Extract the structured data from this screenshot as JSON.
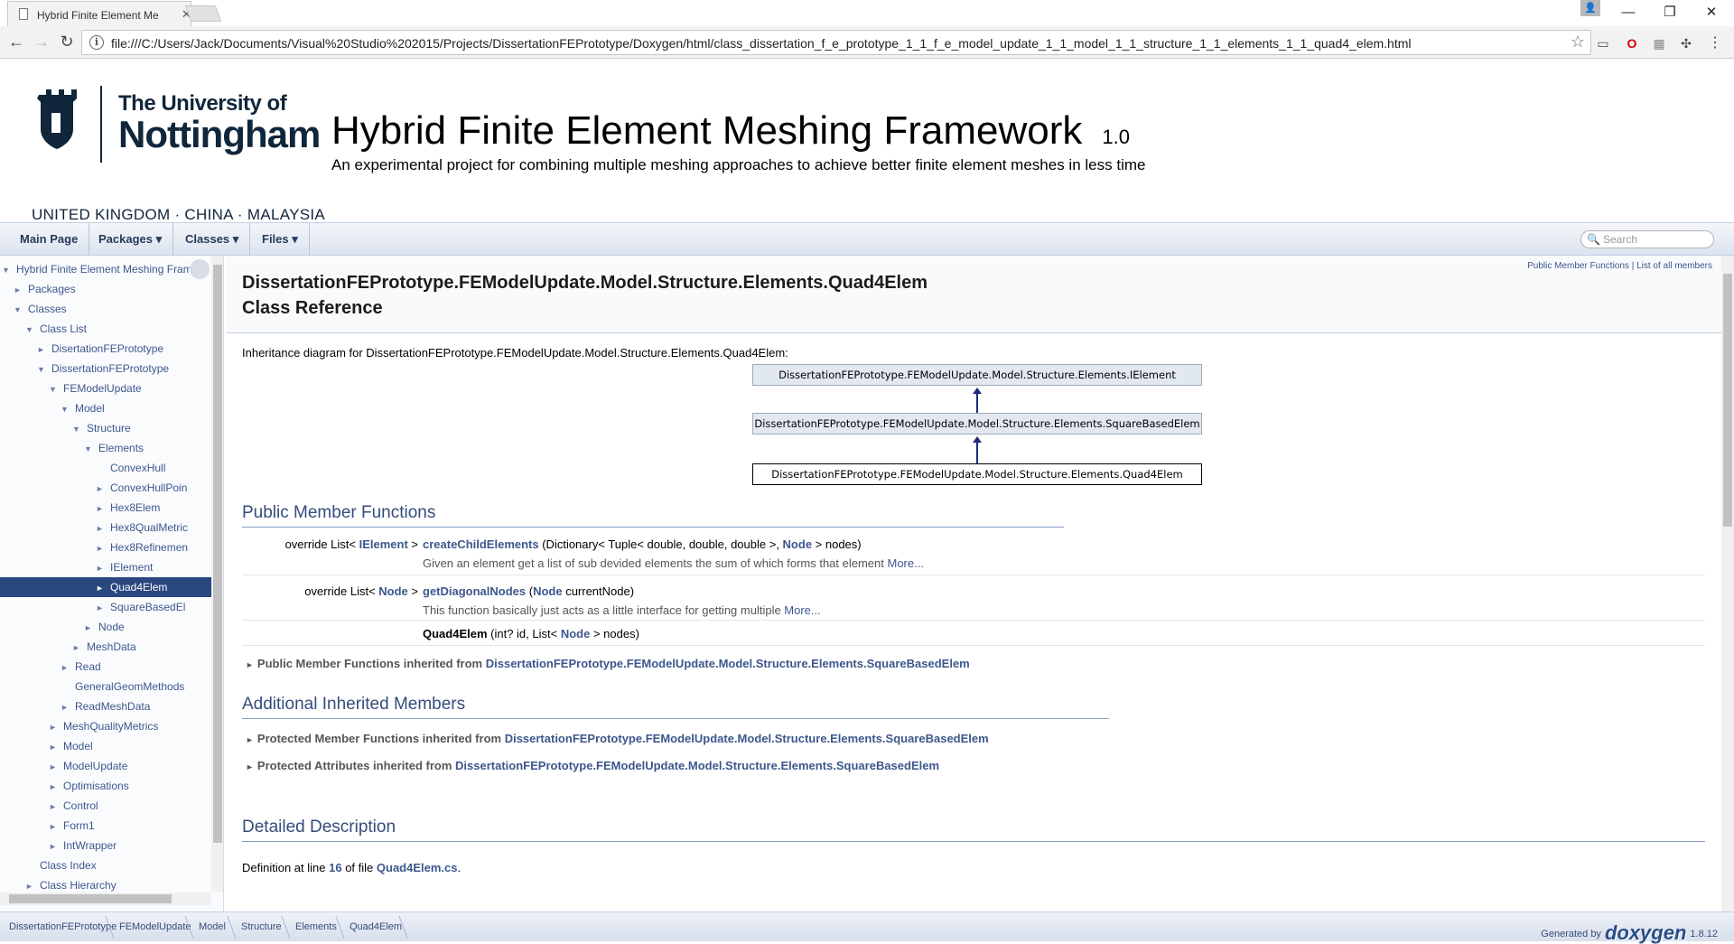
{
  "browser": {
    "tab_title": "Hybrid Finite Element Me",
    "url": "file:///C:/Users/Jack/Documents/Visual%20Studio%202015/Projects/DissertationFEPrototype/Doxygen/html/class_dissertation_f_e_prototype_1_1_f_e_model_update_1_1_model_1_1_structure_1_1_elements_1_1_quad4_elem.html"
  },
  "header": {
    "logo_line1": "The University of",
    "logo_line2": "Nottingham",
    "logo_countries": "UNITED KINGDOM · CHINA · MALAYSIA",
    "project_name": "Hybrid Finite Element Meshing Framework",
    "project_number": "1.0",
    "project_brief": "An experimental project for combining multiple meshing approaches to achieve better finite element meshes in less time"
  },
  "nav": {
    "main_page": "Main Page",
    "packages": "Packages",
    "classes": "Classes",
    "files": "Files",
    "search_placeholder": "Search"
  },
  "tree": [
    {
      "label": "Hybrid Finite Element Meshing Framew",
      "arrow": "▼",
      "depth": 0
    },
    {
      "label": "Packages",
      "arrow": "►",
      "depth": 1
    },
    {
      "label": "Classes",
      "arrow": "▼",
      "depth": 1
    },
    {
      "label": "Class List",
      "arrow": "▼",
      "depth": 2
    },
    {
      "label": "DisertationFEPrototype",
      "arrow": "►",
      "depth": 3
    },
    {
      "label": "DissertationFEPrototype",
      "arrow": "▼",
      "depth": 3
    },
    {
      "label": "FEModelUpdate",
      "arrow": "▼",
      "depth": 4
    },
    {
      "label": "Model",
      "arrow": "▼",
      "depth": 5
    },
    {
      "label": "Structure",
      "arrow": "▼",
      "depth": 6
    },
    {
      "label": "Elements",
      "arrow": "▼",
      "depth": 7
    },
    {
      "label": "ConvexHull",
      "arrow": "",
      "depth": 8
    },
    {
      "label": "ConvexHullPoin",
      "arrow": "►",
      "depth": 8
    },
    {
      "label": "Hex8Elem",
      "arrow": "►",
      "depth": 8
    },
    {
      "label": "Hex8QualMetric",
      "arrow": "►",
      "depth": 8
    },
    {
      "label": "Hex8Refinemen",
      "arrow": "►",
      "depth": 8
    },
    {
      "label": "IElement",
      "arrow": "►",
      "depth": 8
    },
    {
      "label": "Quad4Elem",
      "arrow": "►",
      "depth": 8,
      "selected": true
    },
    {
      "label": "SquareBasedEl",
      "arrow": "►",
      "depth": 8
    },
    {
      "label": "Node",
      "arrow": "►",
      "depth": 7
    },
    {
      "label": "MeshData",
      "arrow": "►",
      "depth": 6
    },
    {
      "label": "Read",
      "arrow": "►",
      "depth": 5
    },
    {
      "label": "GeneralGeomMethods",
      "arrow": "",
      "depth": 5
    },
    {
      "label": "ReadMeshData",
      "arrow": "►",
      "depth": 5
    },
    {
      "label": "MeshQualityMetrics",
      "arrow": "►",
      "depth": 4
    },
    {
      "label": "Model",
      "arrow": "►",
      "depth": 4
    },
    {
      "label": "ModelUpdate",
      "arrow": "►",
      "depth": 4
    },
    {
      "label": "Optimisations",
      "arrow": "►",
      "depth": 4
    },
    {
      "label": "Control",
      "arrow": "►",
      "depth": 4
    },
    {
      "label": "Form1",
      "arrow": "►",
      "depth": 4
    },
    {
      "label": "IntWrapper",
      "arrow": "►",
      "depth": 4
    },
    {
      "label": "Class Index",
      "arrow": "",
      "depth": 2
    },
    {
      "label": "Class Hierarchy",
      "arrow": "►",
      "depth": 2
    }
  ],
  "content": {
    "summary_public": "Public Member Functions",
    "summary_sep": " | ",
    "summary_all": "List of all members",
    "title_line1": "DissertationFEPrototype.FEModelUpdate.Model.Structure.Elements.Quad4Elem",
    "title_line2": "Class Reference",
    "inheritance_text": "Inheritance diagram for DissertationFEPrototype.FEModelUpdate.Model.Structure.Elements.Quad4Elem:",
    "inh_top": "DissertationFEPrototype.FEModelUpdate.Model.Structure.Elements.IElement",
    "inh_mid": "DissertationFEPrototype.FEModelUpdate.Model.Structure.Elements.SquareBasedElem",
    "inh_bot": "DissertationFEPrototype.FEModelUpdate.Model.Structure.Elements.Quad4Elem",
    "public_title": "Public Member Functions",
    "m1_type_pre": "override List< ",
    "m1_type_link": "IElement",
    "m1_type_post": " >",
    "m1_name": "createChildElements",
    "m1_args_pre": " (Dictionary< Tuple< double, double, double >, ",
    "m1_args_link": "Node",
    "m1_args_post": " > nodes)",
    "m1_desc": "Given an element get a list of sub devided elements the sum of which forms that element ",
    "m1_more": "More...",
    "m2_type_pre": "override List< ",
    "m2_type_link": "Node",
    "m2_type_post": " >",
    "m2_name": "getDiagonalNodes",
    "m2_args_pre": " (",
    "m2_args_link": "Node",
    "m2_args_post": " currentNode)",
    "m2_desc": "This function basically just acts as a little interface for getting multiple ",
    "m2_more": "More...",
    "m3_name": "Quad4Elem",
    "m3_args_pre": " (int? id, List< ",
    "m3_args_link": "Node",
    "m3_args_post": " > nodes)",
    "inh_pub_label": "Public Member Functions inherited from ",
    "inh_pub_link": "DissertationFEPrototype.FEModelUpdate.Model.Structure.Elements.SquareBasedElem",
    "additional_title": "Additional Inherited Members",
    "inh_prot_fn_label": "Protected Member Functions inherited from ",
    "inh_prot_fn_link": "DissertationFEPrototype.FEModelUpdate.Model.Structure.Elements.SquareBasedElem",
    "inh_prot_attr_label": "Protected Attributes inherited from ",
    "inh_prot_attr_link": "DissertationFEPrototype.FEModelUpdate.Model.Structure.Elements.SquareBasedElem",
    "detailed_title": "Detailed Description",
    "def_pre": "Definition at line ",
    "def_line": "16",
    "def_mid": " of file ",
    "def_file": "Quad4Elem.cs",
    "def_post": "."
  },
  "footer": {
    "crumbs": [
      "DissertationFEPrototype",
      "FEModelUpdate",
      "Model",
      "Structure",
      "Elements",
      "Quad4Elem"
    ],
    "generated_by": "Generated by",
    "doxygen": "doxygen",
    "version": "1.8.12"
  },
  "icons": {
    "tree_expanded": "triangle-down-icon",
    "tree_collapsed": "triangle-right-icon"
  }
}
